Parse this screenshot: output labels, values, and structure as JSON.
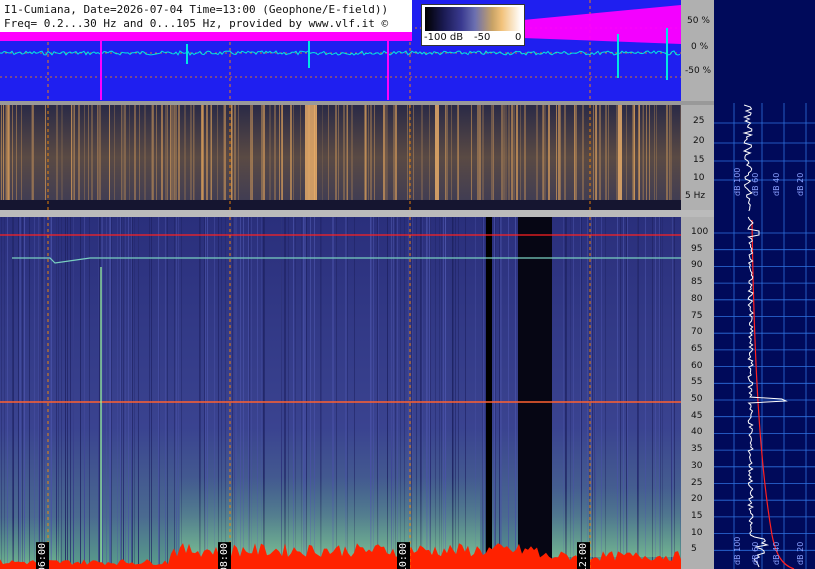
{
  "header": {
    "line1": "I1-Cumiana, Date=2026-07-04 Time=13:00 (Geophone/E-field))",
    "line2": "Freq= 0.2...30 Hz and 0...105 Hz, provided by www.vlf.it ©"
  },
  "colorbar": {
    "min_label": "-100 dB",
    "mid_label": "-50",
    "max_label": "0"
  },
  "waveform_scale": [
    "50 %",
    "0 %",
    "-50 %"
  ],
  "low_freq_scale": [
    "25",
    "20",
    "15",
    "10",
    "5 Hz"
  ],
  "high_freq_scale": [
    "100",
    "95",
    "90",
    "85",
    "80",
    "75",
    "70",
    "65",
    "60",
    "55",
    "50",
    "45",
    "40",
    "35",
    "30",
    "25",
    "20",
    "15",
    "10",
    "5"
  ],
  "time_labels": [
    "06:00",
    "08:00",
    "10:00",
    "12:00"
  ],
  "side_top_labels": [
    "dB 100",
    "dB 60",
    "dB 40",
    "dB 20"
  ],
  "side_bottom_labels": [
    "dB 100",
    "dB 60",
    "dB 40",
    "dB 20"
  ],
  "colors": {
    "waveform_bg": "#1f1ff0",
    "waveform_trace": "#00e5e5",
    "magenta": "#ff00ff",
    "spectro_bg": "#2b2f7a",
    "red_band": "#ff2200",
    "side_bg": "#000a5a"
  }
}
